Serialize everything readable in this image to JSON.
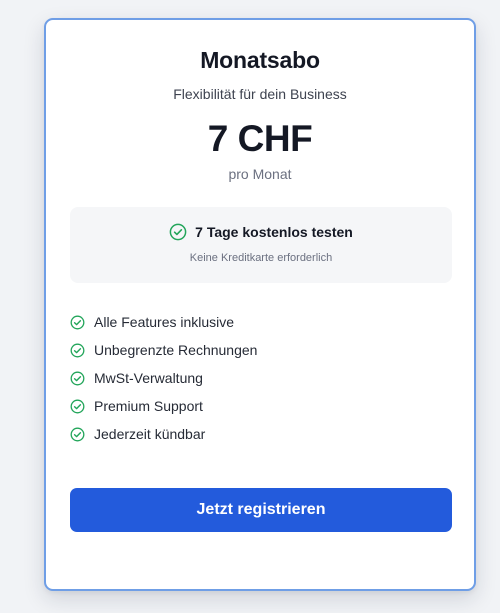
{
  "plan": {
    "title": "Monatsabo",
    "subtitle": "Flexibilität für dein Business",
    "price": "7 CHF",
    "period": "pro Monat"
  },
  "trial": {
    "title": "7 Tage kostenlos testen",
    "note": "Keine Kreditkarte erforderlich",
    "icon": "check-circle-icon"
  },
  "features": [
    {
      "label": "Alle Features inklusive",
      "icon": "check-circle-icon"
    },
    {
      "label": "Unbegrenzte Rechnungen",
      "icon": "check-circle-icon"
    },
    {
      "label": "MwSt-Verwaltung",
      "icon": "check-circle-icon"
    },
    {
      "label": "Premium Support",
      "icon": "check-circle-icon"
    },
    {
      "label": "Jederzeit kündbar",
      "icon": "check-circle-icon"
    }
  ],
  "cta": {
    "label": "Jetzt registrieren"
  },
  "colors": {
    "accent": "#235bdc",
    "check": "#22a55a",
    "card_border": "#6f9ee6"
  }
}
